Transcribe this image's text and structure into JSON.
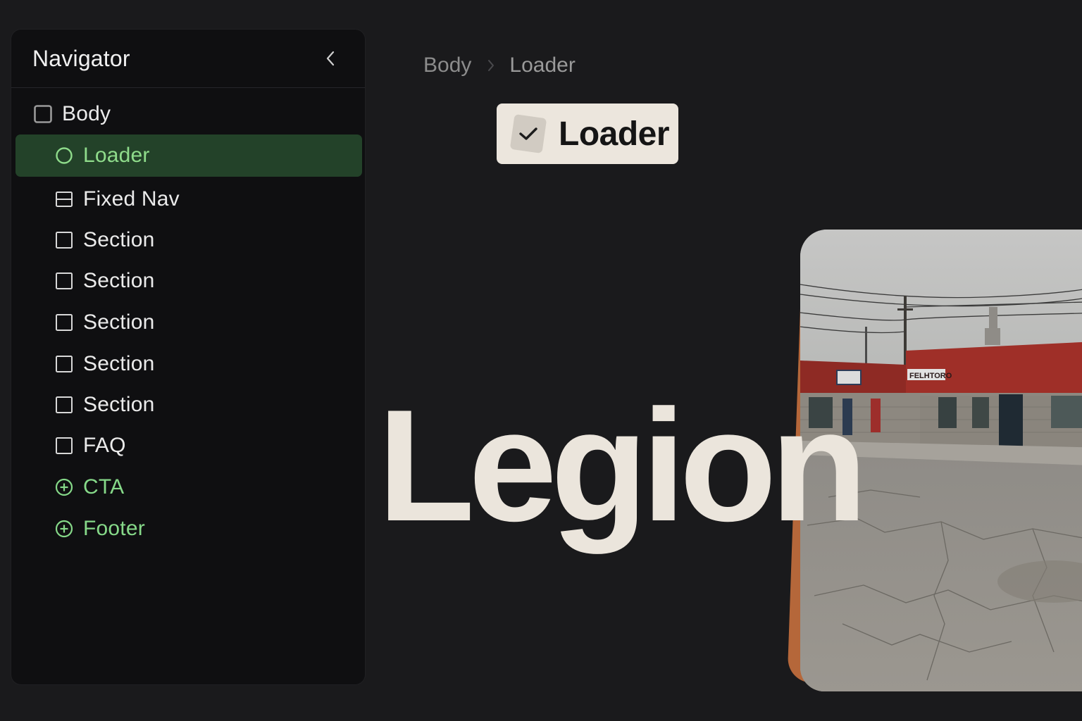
{
  "navigator": {
    "title": "Navigator",
    "items": [
      {
        "label": "Body",
        "icon": "square-outline-icon",
        "level": 0
      },
      {
        "label": "Loader",
        "icon": "circle-outline-icon",
        "level": 1,
        "selected": true
      },
      {
        "label": "Fixed Nav",
        "icon": "split-rectangle-icon",
        "level": 1
      },
      {
        "label": "Section",
        "icon": "square-outline-icon",
        "level": 1
      },
      {
        "label": "Section",
        "icon": "square-outline-icon",
        "level": 1
      },
      {
        "label": "Section",
        "icon": "square-outline-icon",
        "level": 1
      },
      {
        "label": "Section",
        "icon": "square-outline-icon",
        "level": 1
      },
      {
        "label": "Section",
        "icon": "square-outline-icon",
        "level": 1
      },
      {
        "label": "FAQ",
        "icon": "square-outline-icon",
        "level": 1
      },
      {
        "label": "CTA",
        "icon": "plus-circle-icon",
        "level": 1
      },
      {
        "label": "Footer",
        "icon": "plus-circle-icon",
        "level": 1
      }
    ]
  },
  "breadcrumb": {
    "items": [
      "Body",
      "Loader"
    ]
  },
  "selected_element": {
    "label": "Loader"
  },
  "canvas": {
    "heading": "Legion",
    "photo_sign": "FELHTORO"
  },
  "colors": {
    "background": "#1a1a1c",
    "panel": "#0f0f11",
    "selection": "#234229",
    "accent_green": "#8fdc8b",
    "badge": "#ece6dd",
    "heading": "#ebe5dc"
  }
}
